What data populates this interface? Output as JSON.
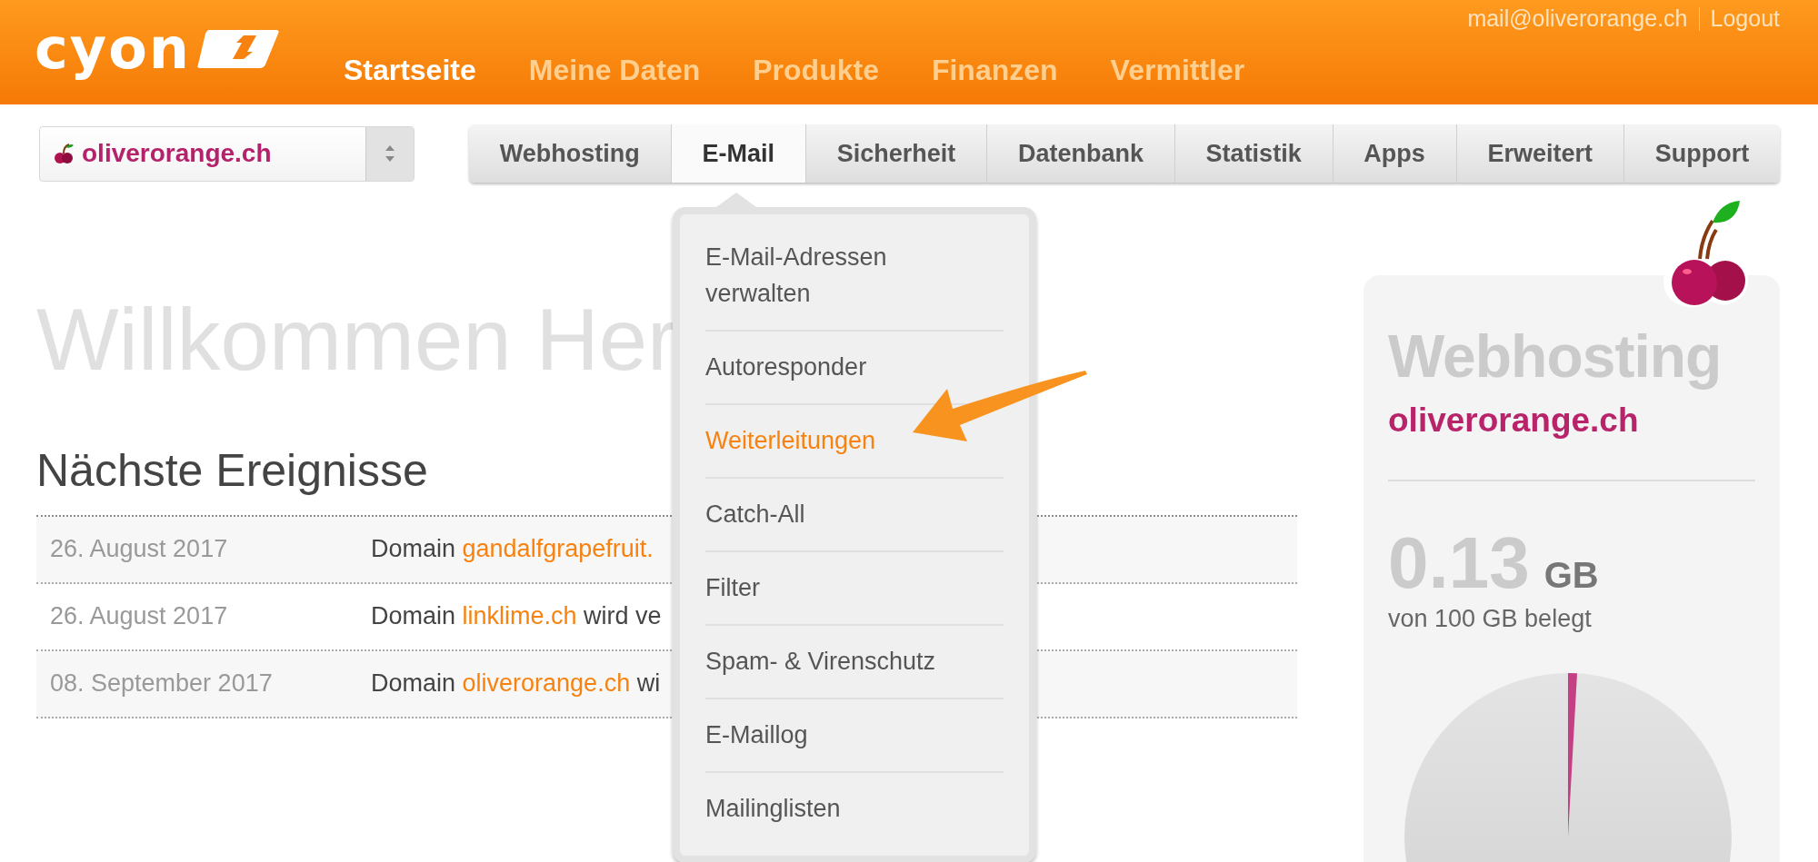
{
  "header": {
    "logo": "cyon",
    "nav": [
      {
        "label": "Startseite",
        "selected": true
      },
      {
        "label": "Meine Daten",
        "selected": false
      },
      {
        "label": "Produkte",
        "selected": false
      },
      {
        "label": "Finanzen",
        "selected": false
      },
      {
        "label": "Vermittler",
        "selected": false
      }
    ],
    "account": {
      "email": "mail@oliverorange.ch",
      "logout": "Logout"
    }
  },
  "domain_select": {
    "value": "oliverorange.ch"
  },
  "tabs": [
    {
      "label": "Webhosting",
      "selected": false
    },
    {
      "label": "E-Mail",
      "selected": true
    },
    {
      "label": "Sicherheit",
      "selected": false
    },
    {
      "label": "Datenbank",
      "selected": false
    },
    {
      "label": "Statistik",
      "selected": false
    },
    {
      "label": "Apps",
      "selected": false
    },
    {
      "label": "Erweitert",
      "selected": false
    },
    {
      "label": "Support",
      "selected": false
    }
  ],
  "dropdown": {
    "items": [
      {
        "label": "E-Mail-Adressen verwalten",
        "selected": false
      },
      {
        "label": "Autoresponder",
        "selected": false
      },
      {
        "label": "Weiterleitungen",
        "selected": true
      },
      {
        "label": "Catch-All",
        "selected": false
      },
      {
        "label": "Filter",
        "selected": false
      },
      {
        "label": "Spam- & Virenschutz",
        "selected": false
      },
      {
        "label": "E-Maillog",
        "selected": false
      },
      {
        "label": "Mailinglisten",
        "selected": false
      }
    ]
  },
  "welcome_title": "Willkommen Her",
  "events": {
    "title": "Nächste Ereignisse",
    "rows": [
      {
        "date": "26. August 2017",
        "prefix": "Domain",
        "link": "gandalfgrapefruit."
      },
      {
        "date": "26. August 2017",
        "prefix": "Domain",
        "link": "linklime.ch",
        "suffix": "wird ve"
      },
      {
        "date": "08. September 2017",
        "prefix": "Domain",
        "link": "oliverorange.ch",
        "suffix": "wi"
      }
    ]
  },
  "hosting_panel": {
    "title": "Webhosting",
    "domain": "oliverorange.ch",
    "usage_value": "0.13",
    "usage_unit": "GB",
    "usage_caption": "von 100 GB belegt"
  }
}
